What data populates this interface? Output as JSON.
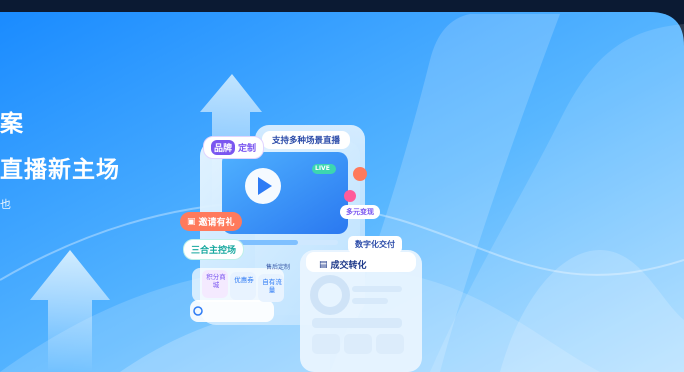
{
  "hero": {
    "line1": "案",
    "line2": "直播新主场",
    "line3": "也"
  },
  "phone": {
    "title": "支持多种场景直播",
    "live_badge": "LIVE",
    "buy_label": "售后定制",
    "tiles": [
      "积分商城",
      "优惠券",
      "自有流量"
    ]
  },
  "chips": {
    "brand": "品牌",
    "custom": "定制",
    "invite": "邀请有礼",
    "anchor": "三合主控场",
    "multi": "多元变现",
    "digital": "数字化交付",
    "conversion": "成交转化"
  },
  "colors": {
    "brand_purple": "#7a56f0",
    "coral": "#ff7a5c",
    "teal": "#2bc7c0",
    "blue": "#2d7bf5",
    "pink": "#ff5c9a"
  }
}
